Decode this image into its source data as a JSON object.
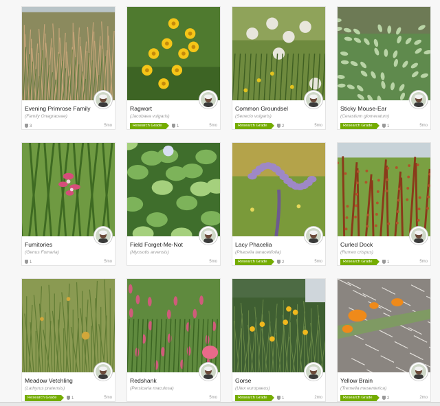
{
  "cards": [
    {
      "name": "Evening Primrose Family",
      "sci": "(Family Onagraceae)",
      "research_grade": "",
      "ids": "3",
      "time": "5mo",
      "photo": "grass-tan"
    },
    {
      "name": "Ragwort",
      "sci": "(Jacobaea vulgaris)",
      "research_grade": "Research Grade",
      "ids": "1",
      "time": "5mo",
      "photo": "yellow-daisies"
    },
    {
      "name": "Common Groundsel",
      "sci": "(Senecio vulgaris)",
      "research_grade": "Research Grade",
      "ids": "2",
      "time": "5mo",
      "photo": "seedheads"
    },
    {
      "name": "Sticky Mouse-Ear",
      "sci": "(Cerastium glomeratum)",
      "research_grade": "Research Grade",
      "ids": "1",
      "time": "5mo",
      "photo": "fuzzy-green"
    },
    {
      "name": "Fumitories",
      "sci": "(Genus Fumaria)",
      "research_grade": "",
      "ids": "1",
      "time": "5mo",
      "photo": "pink-orchid"
    },
    {
      "name": "Field Forget-Me-Not",
      "sci": "(Myosotis arvensis)",
      "research_grade": "",
      "ids": "",
      "time": "5mo",
      "photo": "leafy-green"
    },
    {
      "name": "Lacy Phacelia",
      "sci": "(Phacelia tanacetifolia)",
      "research_grade": "Research Grade",
      "ids": "2",
      "time": "5mo",
      "photo": "purple-curl"
    },
    {
      "name": "Curled Dock",
      "sci": "(Rumex crispus)",
      "research_grade": "Research Grade",
      "ids": "1",
      "time": "5mo",
      "photo": "rusty-dock"
    },
    {
      "name": "Meadow Vetchling",
      "sci": "(Lathyrus pratensis)",
      "research_grade": "Research Grade",
      "ids": "1",
      "time": "5mo",
      "photo": "meadow"
    },
    {
      "name": "Redshank",
      "sci": "(Persicaria maculosa)",
      "research_grade": "",
      "ids": "",
      "time": "5mo",
      "photo": "pink-spikes"
    },
    {
      "name": "Gorse",
      "sci": "(Ulex europaeus)",
      "research_grade": "Research Grade",
      "ids": "1",
      "time": "2mo",
      "photo": "gorse"
    },
    {
      "name": "Yellow Brain",
      "sci": "(Tremella mesenterica)",
      "research_grade": "Research Grade",
      "ids": "2",
      "time": "2mo",
      "photo": "orange-fungus"
    }
  ],
  "colors": {
    "research_grade": "#74ac00",
    "card_bg": "#ffffff",
    "page_bg": "#f7f7f7"
  }
}
